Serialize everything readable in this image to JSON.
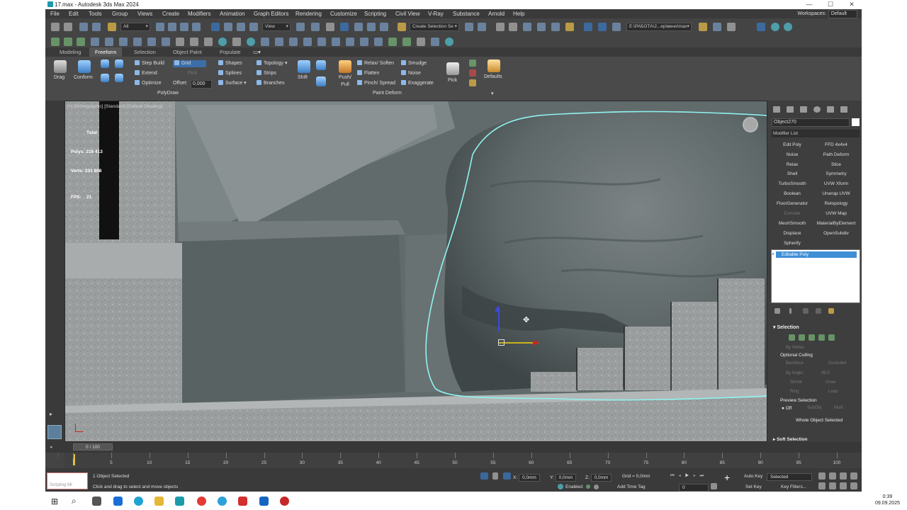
{
  "window": {
    "title": "17.max - Autodesk 3ds Max 2024",
    "controls": [
      "—",
      "☐",
      "✕"
    ]
  },
  "menu": [
    "File",
    "Edit",
    "Tools",
    "Group",
    "Views",
    "Create",
    "Modifiers",
    "Animation",
    "Graph Editors",
    "Rendering",
    "Customize",
    "Scripting",
    "Civil View",
    "V-Ray",
    "Substance",
    "Arnold",
    "Help"
  ],
  "workspace": {
    "label": "Workspaces:",
    "value": "Default"
  },
  "toolbar": {
    "filter": "All",
    "ref_coord": "View",
    "selection_set": "Create Selection Se",
    "path": "E:\\РАБОТА\\2...ер\\вено\\max"
  },
  "ribbon": {
    "tabs": [
      "Modeling",
      "Freeform",
      "Selection",
      "Object Paint",
      "Populate"
    ],
    "active_tab": "Freeform",
    "drag": "Drag",
    "conform": "Conform",
    "step_build": "Step Build",
    "extend": "Extend",
    "optimize": "Optimize",
    "grid": "Grid",
    "pick": "Pick",
    "offset_label": "Offset:",
    "offset_value": "0,000",
    "shapes": "Shapes",
    "splines": "Splines",
    "surface": "Surface",
    "topology": "Topology",
    "strips": "Strips",
    "branches": "Branches",
    "polydraw": "PolyDraw",
    "shift": "Shift",
    "push_pull": "Push/ Pull",
    "relax_soften": "Relax/ Soften",
    "flatten": "Flatten",
    "pinch_spread": "Pinch/ Spread",
    "smudge": "Smudge",
    "noise": "Noise",
    "exaggerate": "Exaggerate",
    "paint_deform": "Paint Deform",
    "pick2": "Pick",
    "defaults": "Defaults"
  },
  "viewport": {
    "label": "[+] [Orthographic] [Standard] [Default Shading]",
    "stats": {
      "total": "Total",
      "polys_label": "Polys:",
      "polys": "216 413",
      "verts_label": "Verts:",
      "verts": "231 808",
      "fps_label": "FPS:",
      "fps": "21"
    }
  },
  "command_panel": {
    "object_name": "Object270",
    "modifier_list": "Modifier List",
    "modifiers_left": [
      "Edit Poly",
      "Noise",
      "Relax",
      "Shell",
      "TurboSmooth",
      "Boolean",
      "FloorGenerator",
      "Extrude",
      "MeshSmooth",
      "Displace",
      "Spherify"
    ],
    "modifiers_right": [
      "FFD 4x4x4",
      "Path Deform",
      "Slice",
      "Symmetry",
      "UVW Xform",
      "Unwrap UVW",
      "Retopology",
      "UVW Map",
      "MaterialByElement",
      "OpenSubdiv"
    ],
    "stack_item": "Editable Poly",
    "selection": "Selection",
    "by_vertex": "By Vertex",
    "optional_culling": "Optional Culling",
    "backface": "Backface",
    "occluded": "Occluded",
    "by_angle": "By Angle:",
    "angle_value": "45,0",
    "shrink": "Shrink",
    "grow": "Grow",
    "ring": "Ring",
    "loop": "Loop",
    "preview_selection": "Preview Selection",
    "off": "Off",
    "subobj": "SubObj",
    "multi": "Multi",
    "whole_object": "Whole Object Selected",
    "soft_selection": "Soft Selection"
  },
  "timeline": {
    "frame": "0 / 100",
    "ticks": [
      "0",
      "5",
      "10",
      "15",
      "20",
      "25",
      "30",
      "35",
      "40",
      "45",
      "50",
      "55",
      "60",
      "65",
      "70",
      "75",
      "80",
      "85",
      "90",
      "95",
      "100"
    ]
  },
  "status": {
    "script": "Scripting Mi:",
    "selected": "1 Object Selected",
    "hint": "Click and drag to select and move objects",
    "x_label": "X:",
    "x": "0,0mm",
    "y_label": "Y:",
    "y": "0,0mm",
    "z_label": "Z:",
    "z": "0,0mm",
    "grid": "Grid = 0,0mm",
    "enabled": "Enabled:",
    "add_time_tag": "Add Time Tag",
    "auto_key": "Auto Key",
    "set_key": "Set Key",
    "selected_dd": "Selected",
    "key_filters": "Key Filters...",
    "frame": "0"
  },
  "taskbar": {
    "time": "0:39",
    "date": "09.09.2025"
  },
  "colors": {
    "selection_outline": "#8ff3f0",
    "panel": "#444444",
    "highlight": "#3f8fd6"
  }
}
